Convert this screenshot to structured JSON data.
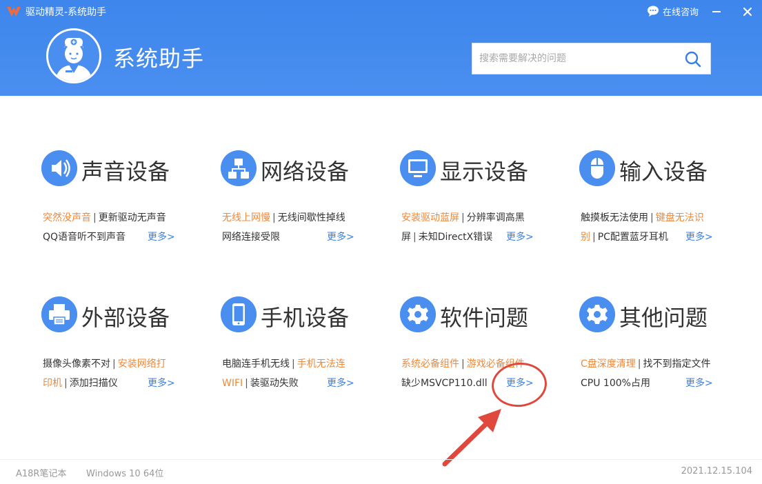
{
  "window": {
    "title": "驱动精灵-系统助手",
    "consult_label": "在线咨询"
  },
  "header": {
    "title": "系统助手",
    "search_placeholder": "搜索需要解决的问题"
  },
  "categories": [
    {
      "title": "声音设备",
      "icon": "speaker-icon",
      "line1": [
        {
          "text": "突然没声音",
          "hot": true
        },
        {
          "text": "更新驱动无声音",
          "hot": false
        }
      ],
      "line2": [
        {
          "text": "QQ语音听不到声音",
          "hot": false
        }
      ],
      "more": "更多>"
    },
    {
      "title": "网络设备",
      "icon": "network-icon",
      "line1": [
        {
          "text": "无线上网慢",
          "hot": true
        },
        {
          "text": "无线间歇性掉线",
          "hot": false
        }
      ],
      "line2": [
        {
          "text": "网络连接受限",
          "hot": false
        }
      ],
      "more": "更多>"
    },
    {
      "title": "显示设备",
      "icon": "monitor-icon",
      "line1": [
        {
          "text": "安装驱动蓝屏",
          "hot": true
        },
        {
          "text": "分辨率调高黑",
          "hot": false
        }
      ],
      "line2": [
        {
          "text": "屏",
          "hot": false
        },
        {
          "text": "未知DirectX错误",
          "hot": false
        }
      ],
      "more": "更多>"
    },
    {
      "title": "输入设备",
      "icon": "mouse-icon",
      "line1": [
        {
          "text": "触摸板无法使用",
          "hot": false
        },
        {
          "text": "键盘无法识",
          "hot": true
        }
      ],
      "line2": [
        {
          "text": "别",
          "hot": true
        },
        {
          "text": "PC配置蓝牙耳机",
          "hot": false
        }
      ],
      "more": "更多>"
    },
    {
      "title": "外部设备",
      "icon": "printer-icon",
      "line1": [
        {
          "text": "摄像头像素不对",
          "hot": false
        },
        {
          "text": "安装网络打",
          "hot": true
        }
      ],
      "line2": [
        {
          "text": "印机",
          "hot": true
        },
        {
          "text": "添加扫描仪",
          "hot": false
        }
      ],
      "more": "更多>"
    },
    {
      "title": "手机设备",
      "icon": "phone-icon",
      "line1": [
        {
          "text": "电脑连手机无线",
          "hot": false
        },
        {
          "text": "手机无法连",
          "hot": true
        }
      ],
      "line2": [
        {
          "text": "WIFI",
          "hot": true
        },
        {
          "text": "装驱动失败",
          "hot": false
        }
      ],
      "more": "更多>"
    },
    {
      "title": "软件问题",
      "icon": "gear-icon",
      "line1": [
        {
          "text": "系统必备组件",
          "hot": true
        },
        {
          "text": "游戏必备组件",
          "hot": true
        }
      ],
      "line2": [
        {
          "text": "缺少MSVCP110.dll",
          "hot": false
        }
      ],
      "more": "更多>"
    },
    {
      "title": "其他问题",
      "icon": "gear-icon",
      "line1": [
        {
          "text": "C盘深度清理",
          "hot": true
        },
        {
          "text": "找不到指定文件",
          "hot": false
        }
      ],
      "line2": [
        {
          "text": "CPU 100%占用",
          "hot": false
        }
      ],
      "more": "更多>"
    }
  ],
  "footer": {
    "model": "A18R笔记本",
    "os": "Windows 10 64位",
    "version": "2021.12.15.104"
  },
  "colors": {
    "header_blue": "#4a8ff0",
    "hot_orange": "#f0883a",
    "link_blue": "#3a7fe0",
    "annotation_red": "#e0483e"
  }
}
